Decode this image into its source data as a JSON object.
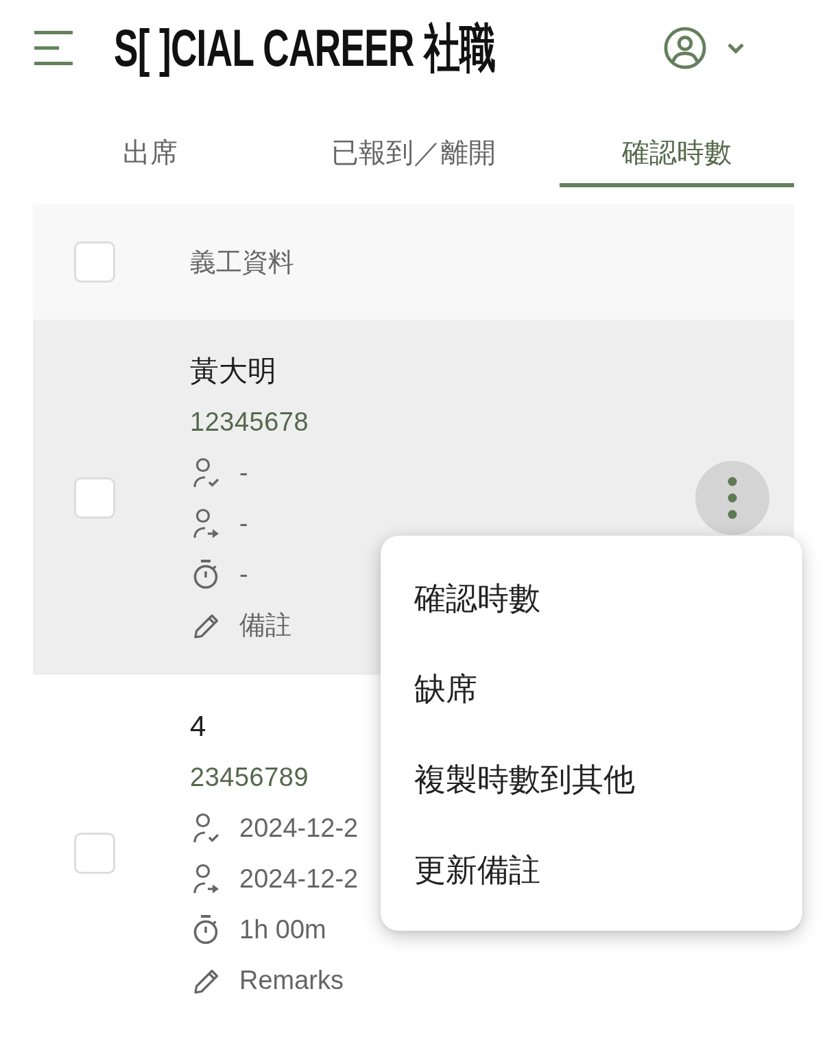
{
  "header": {
    "logo": "S[ ]CIAL CAREER 社職"
  },
  "tabs": [
    {
      "label": "出席",
      "selected": false
    },
    {
      "label": "已報到／離開",
      "selected": false
    },
    {
      "label": "確認時數",
      "selected": true
    }
  ],
  "table": {
    "column_header": "義工資料",
    "select_all_checked": false,
    "rows": [
      {
        "name": "黃大明",
        "id": "12345678",
        "checked": false,
        "active": true,
        "details": [
          {
            "kind": "check_in",
            "value": "-"
          },
          {
            "kind": "check_out",
            "value": "-"
          },
          {
            "kind": "duration",
            "value": "-"
          },
          {
            "kind": "remarks",
            "value": "備註"
          }
        ]
      },
      {
        "name": "4",
        "id": "23456789",
        "checked": false,
        "active": false,
        "details": [
          {
            "kind": "check_in",
            "value": "2024-12-2"
          },
          {
            "kind": "check_out",
            "value": "2024-12-2"
          },
          {
            "kind": "duration",
            "value": "1h 00m"
          },
          {
            "kind": "remarks",
            "value": "Remarks"
          }
        ]
      }
    ]
  },
  "menu": {
    "items": [
      "確認時數",
      "缺席",
      "複製時數到其他",
      "更新備註"
    ]
  }
}
